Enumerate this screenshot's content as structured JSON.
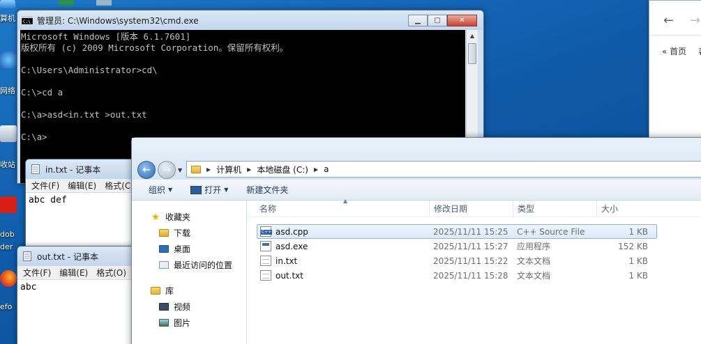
{
  "desktop": {
    "labels": [
      "算机",
      "网络",
      "收站",
      "dob",
      "der",
      "efo"
    ]
  },
  "cmd": {
    "title": "管理员: C:\\Windows\\system32\\cmd.exe",
    "lines": [
      "Microsoft Windows [版本 6.1.7601]",
      "版权所有 (c) 2009 Microsoft Corporation。保留所有权利。",
      "",
      "C:\\Users\\Administrator>cd\\",
      "",
      "C:\\>cd a",
      "",
      "C:\\a>asd<in.txt >out.txt",
      "",
      "C:\\a>"
    ]
  },
  "browser": {
    "back": "←",
    "forward": "→",
    "home_link": "« 首页",
    "partial": "表"
  },
  "notepad_in": {
    "title": "in.txt - 记事本",
    "menu": [
      "文件(F)",
      "编辑(E)",
      "格式(C"
    ],
    "content": "abc def"
  },
  "notepad_out": {
    "title": "out.txt - 记事本",
    "menu": [
      "文件(F)",
      "编辑(E)",
      "格式(O)"
    ],
    "content": "abc"
  },
  "explorer": {
    "breadcrumb": [
      "计算机",
      "本地磁盘 (C:)",
      "a"
    ],
    "toolbar": {
      "organize": "组织",
      "open": "打开",
      "new_folder": "新建文件夹"
    },
    "nav": {
      "favorites": "收藏夹",
      "downloads": "下载",
      "desktop": "桌面",
      "recent": "最近访问的位置",
      "libraries": "库",
      "videos": "视频",
      "pictures": "图片"
    },
    "columns": {
      "name": "名称",
      "date": "修改日期",
      "type": "类型",
      "size": "大小"
    },
    "files": [
      {
        "name": "asd.cpp",
        "date": "2025/11/11 15:25",
        "type": "C++ Source File",
        "size": "1 KB",
        "icon": "cpp"
      },
      {
        "name": "asd.exe",
        "date": "2025/11/11 15:27",
        "type": "应用程序",
        "size": "152 KB",
        "icon": "exe"
      },
      {
        "name": "in.txt",
        "date": "2025/11/11 15:22",
        "type": "文本文档",
        "size": "1 KB",
        "icon": "txt"
      },
      {
        "name": "out.txt",
        "date": "2025/11/11 15:28",
        "type": "文本文档",
        "size": "1 KB",
        "icon": "txt"
      }
    ]
  },
  "colors": {
    "desktop_bg": "#1466b8",
    "console_bg": "#000000",
    "console_fg": "#c0c0c0",
    "selection": "#dbe9f8"
  }
}
